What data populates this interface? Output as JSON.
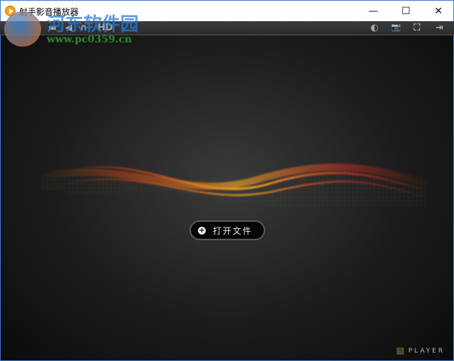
{
  "window": {
    "title": "射手影音播放器",
    "minimize": "—",
    "maximize": "☐",
    "close": "✕"
  },
  "toolbar": {
    "left_items": [
      "▬",
      "◀",
      "∩",
      "HD"
    ],
    "right_items": [
      "◐",
      "📷",
      "⛶",
      "⇥"
    ]
  },
  "main": {
    "open_file_label": "打开文件",
    "open_icon": "+",
    "brand_mark": "S",
    "brand_text": "PLAYER"
  },
  "watermark": {
    "name": "河东软件园",
    "url": "www.pc0359.cn"
  }
}
